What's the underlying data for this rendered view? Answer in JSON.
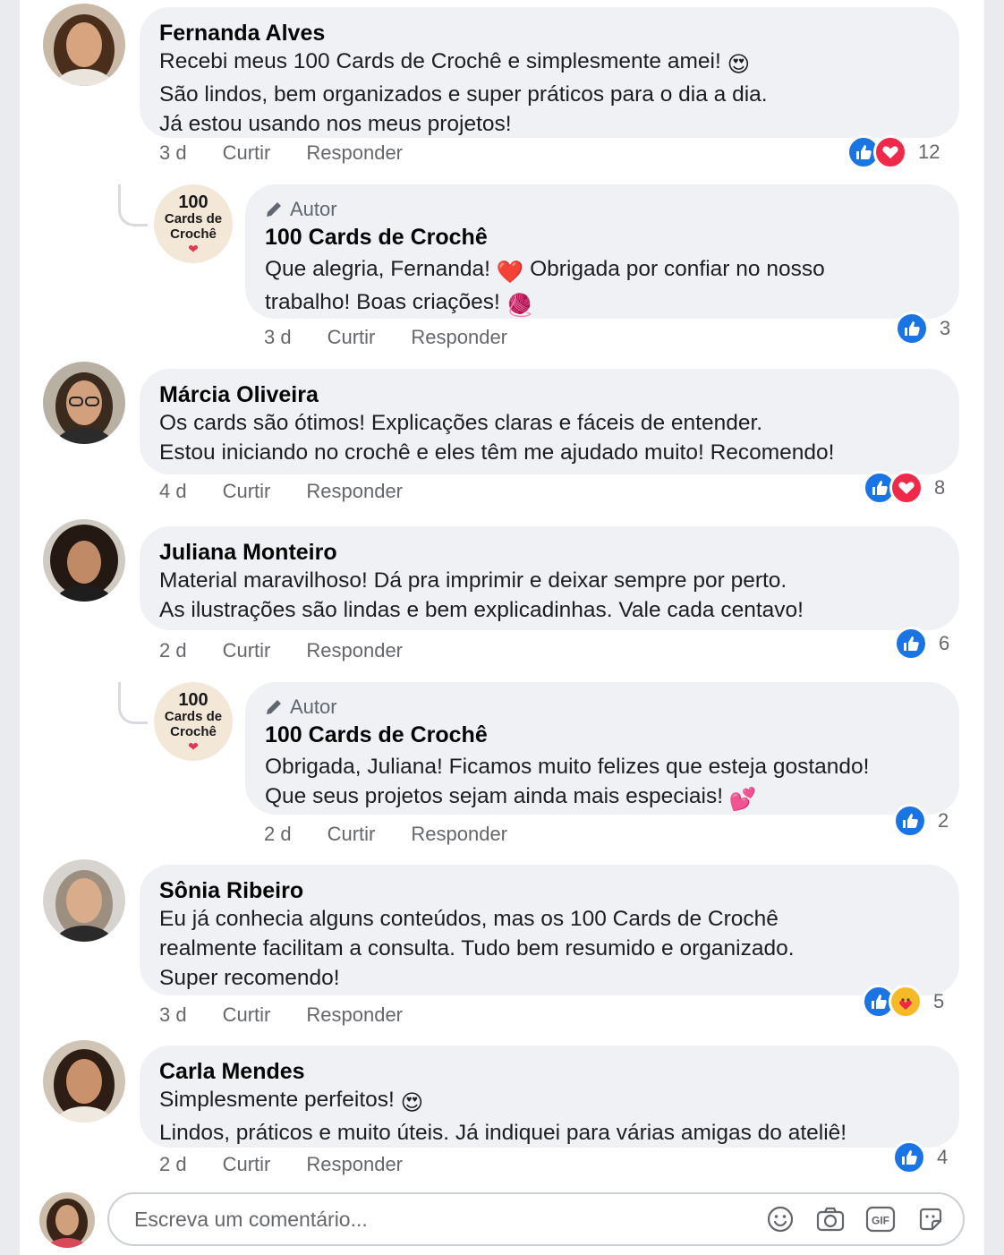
{
  "comments": [
    {
      "name": "Fernanda Alves",
      "lines": [
        "Recebi meus 100 Cards de Crochê e simplesmente amei! ",
        "São lindos, bem organizados e super práticos para o dia a dia.",
        "Já estou usando nos meus projetos!"
      ],
      "emoji_after_line1": "😍",
      "time": "3 d",
      "like": "Curtir",
      "reply": "Responder",
      "reactions": [
        "like-icon",
        "love-icon"
      ],
      "reaction_count": "12"
    },
    {
      "name": "Márcia Oliveira",
      "lines": [
        "Os cards são ótimos! Explicações claras e fáceis de entender.",
        "Estou iniciando no crochê e eles têm me ajudado muito! Recomendo!"
      ],
      "time": "4 d",
      "like": "Curtir",
      "reply": "Responder",
      "reactions": [
        "like-icon",
        "love-icon"
      ],
      "reaction_count": "8"
    },
    {
      "name": "Juliana Monteiro",
      "lines": [
        "Material maravilhoso! Dá pra imprimir e deixar sempre por perto.",
        "As ilustrações são lindas e bem explicadinhas. Vale cada centavo!"
      ],
      "time": "2 d",
      "like": "Curtir",
      "reply": "Responder",
      "reactions": [
        "like-icon"
      ],
      "reaction_count": "6"
    },
    {
      "name": "Sônia Ribeiro",
      "lines": [
        "Eu já conhecia alguns conteúdos, mas os 100 Cards de Crochê",
        "realmente facilitam a consulta. Tudo bem resumido e organizado.",
        "Super recomendo!"
      ],
      "time": "3 d",
      "like": "Curtir",
      "reply": "Responder",
      "reactions": [
        "like-icon",
        "care-icon"
      ],
      "reaction_count": "5"
    },
    {
      "name": "Carla Mendes",
      "lines": [
        "Simplesmente perfeitos! ",
        "Lindos, práticos e muito úteis. Já indiquei para várias amigas do ateliê!"
      ],
      "emoji_after_line1": "😍",
      "time": "2 d",
      "like": "Curtir",
      "reply": "Responder",
      "reactions": [
        "like-icon"
      ],
      "reaction_count": "4"
    }
  ],
  "replies": [
    {
      "author_tag": "Autor",
      "name": "100 Cards de Crochê",
      "logo": {
        "line1": "100",
        "line2": "Cards de",
        "line3": "Crochê",
        "heart": "❤"
      },
      "lines": [
        "Que alegria, Fernanda! ",
        " Obrigada por confiar no nosso",
        "trabalho! Boas criações! "
      ],
      "emoji_inline": "❤️",
      "emoji_end": "🧶",
      "time": "3 d",
      "like": "Curtir",
      "reply": "Responder",
      "reactions": [
        "like-icon"
      ],
      "reaction_count": "3"
    },
    {
      "author_tag": "Autor",
      "name": "100 Cards de Crochê",
      "logo": {
        "line1": "100",
        "line2": "Cards de",
        "line3": "Crochê",
        "heart": "❤"
      },
      "lines": [
        "Obrigada, Juliana! Ficamos muito felizes que esteja gostando!",
        "Que seus projetos sejam ainda mais especiais! "
      ],
      "emoji_end": "💕",
      "time": "2 d",
      "like": "Curtir",
      "reply": "Responder",
      "reactions": [
        "like-icon"
      ],
      "reaction_count": "2"
    }
  ],
  "composer": {
    "placeholder": "Escreva um comentário...",
    "tools": [
      "emoji-icon",
      "camera-icon",
      "gif-icon",
      "sticker-icon"
    ],
    "gif_label": "GIF"
  }
}
